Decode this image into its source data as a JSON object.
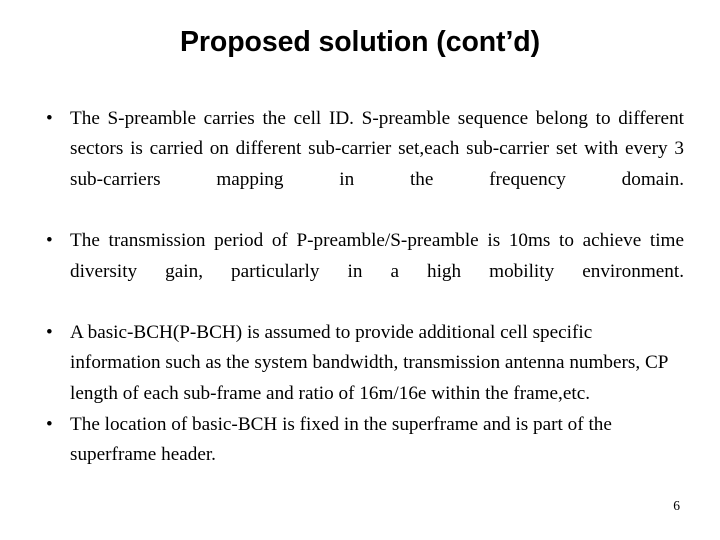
{
  "slide": {
    "title": "Proposed solution (cont’d)",
    "page_number": "6",
    "bullet_marker": "•",
    "text_color": "#000000",
    "background_color": "#ffffff",
    "bullets": [
      {
        "align": "justify",
        "text": "The S-preamble carries the cell ID. S-preamble sequence belong to different sectors is carried on different sub-carrier set,each sub-carrier set with every 3 sub-carriers mapping in the frequency domain."
      },
      {
        "align": "justify",
        "text": "The transmission period of P-preamble/S-preamble is 10ms to achieve time diversity gain, particularly in a high mobility environment."
      },
      {
        "align": "left",
        "text": "A basic-BCH(P-BCH) is assumed to provide additional cell specific information such as the system bandwidth, transmission antenna numbers, CP length of each sub-frame and ratio of 16m/16e within the frame,etc."
      },
      {
        "align": "left",
        "text": "The location of basic-BCH is fixed in the superframe and is part of the superframe header."
      }
    ]
  }
}
